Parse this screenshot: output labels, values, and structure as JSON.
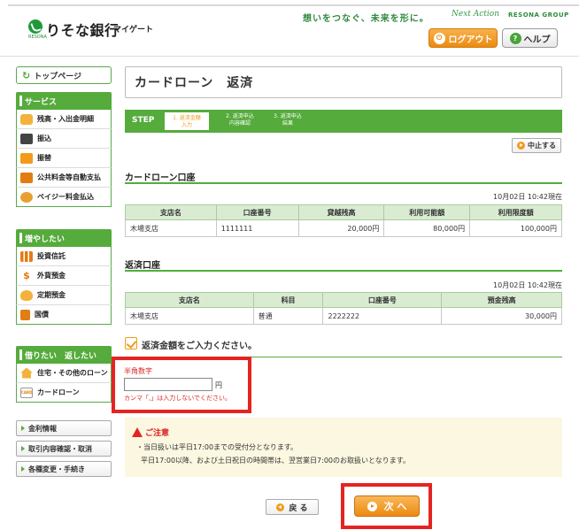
{
  "header": {
    "logo_text": "りそな銀行",
    "logo_sub": "マイゲート",
    "logo_small": "RESONA",
    "tagline": "想いをつなぐ、未来を形に。",
    "tagline_mark": "Next Action",
    "tagline_group": "RESONA GROUP",
    "logout_label": "ログアウト",
    "help_label": "ヘルプ",
    "help_glyph": "?"
  },
  "sidebar": {
    "top_label": "トップページ",
    "sections": [
      {
        "title": "サービス",
        "items": [
          {
            "label": "残高・入出金明細",
            "icon": "wallet-icon"
          },
          {
            "label": "振込",
            "icon": "transfer-icon"
          },
          {
            "label": "振替",
            "icon": "exchange-icon"
          },
          {
            "label": "公共料金等自動支払",
            "icon": "faucet-icon"
          },
          {
            "label": "ペイジー料金払込",
            "icon": "payeasy-icon"
          }
        ]
      },
      {
        "title": "増やしたい",
        "items": [
          {
            "label": "投資信託",
            "icon": "chart-icon"
          },
          {
            "label": "外貨預金",
            "icon": "dollar-icon"
          },
          {
            "label": "定期預金",
            "icon": "moneybag-icon"
          },
          {
            "label": "国債",
            "icon": "bond-icon"
          }
        ]
      },
      {
        "title": "借りたい　返したい",
        "items": [
          {
            "label": "住宅・その他のローン",
            "icon": "house-icon"
          },
          {
            "label": "カードローン",
            "icon": "card-icon",
            "card_text": "CARD"
          }
        ]
      }
    ],
    "links": [
      "金利情報",
      "取引内容確認・取消",
      "各種変更・手続き"
    ]
  },
  "main": {
    "title": "カードローン　返済",
    "step_label": "STEP",
    "steps": [
      "1. 返済金額\n入力",
      "2. 返済申込\n内容確認",
      "3. 返済申込\n結果"
    ],
    "stop_label": "中止する",
    "loan_section": {
      "heading": "カードローン口座",
      "timestamp": "10月02日 10:42現在",
      "columns": [
        "支店名",
        "口座番号",
        "貸越残高",
        "利用可能額",
        "利用限度額"
      ],
      "row": [
        "木場支店",
        "1111111",
        "20,000円",
        "80,000円",
        "100,000円"
      ]
    },
    "repay_section": {
      "heading": "返済口座",
      "timestamp": "10月02日 10:42現在",
      "columns": [
        "支店名",
        "科目",
        "口座番号",
        "預金残高"
      ],
      "row": [
        "木場支店",
        "普通",
        "2222222",
        "30,000円"
      ]
    },
    "instruction": "返済金額をご入力ください。",
    "amount_field": {
      "label": "半角数字",
      "value": "",
      "unit": "円",
      "warning": "カンマ「,」は入力しないでください。"
    },
    "notice": {
      "title": "ご注意",
      "lines": [
        "・当日扱いは平日17:00までの受付分となります。",
        "平日17:00以降、および土日祝日の時間帯は、翌営業日7:00のお取扱いとなります。"
      ]
    },
    "back_label": "戻 る",
    "next_label": "次 へ"
  },
  "colors": {
    "brand_green": "#55ab3c",
    "accent_orange": "#f39a1a",
    "highlight_red": "#e52421"
  }
}
